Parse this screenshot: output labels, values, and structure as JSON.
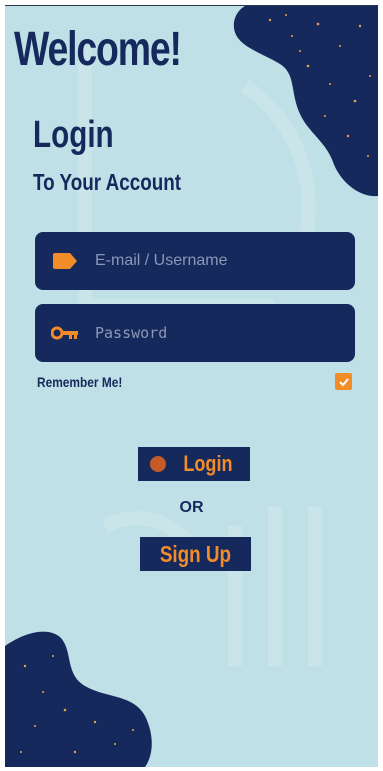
{
  "header": {
    "welcome": "Welcome!",
    "login_title": "Login",
    "subtitle": "To Your Account"
  },
  "form": {
    "username_placeholder": "E-mail / Username",
    "password_placeholder": "Password",
    "remember_label": "Remember Me!",
    "remember_checked": true
  },
  "actions": {
    "login_label": "Login",
    "or_label": "OR",
    "signup_label": "Sign Up"
  },
  "icons": {
    "username": "tag-icon",
    "password": "key-icon",
    "checkbox": "checkmark-icon",
    "login": "dot-icon"
  },
  "colors": {
    "background": "#bfe0e6",
    "primary": "#16295c",
    "accent": "#f28c28"
  }
}
